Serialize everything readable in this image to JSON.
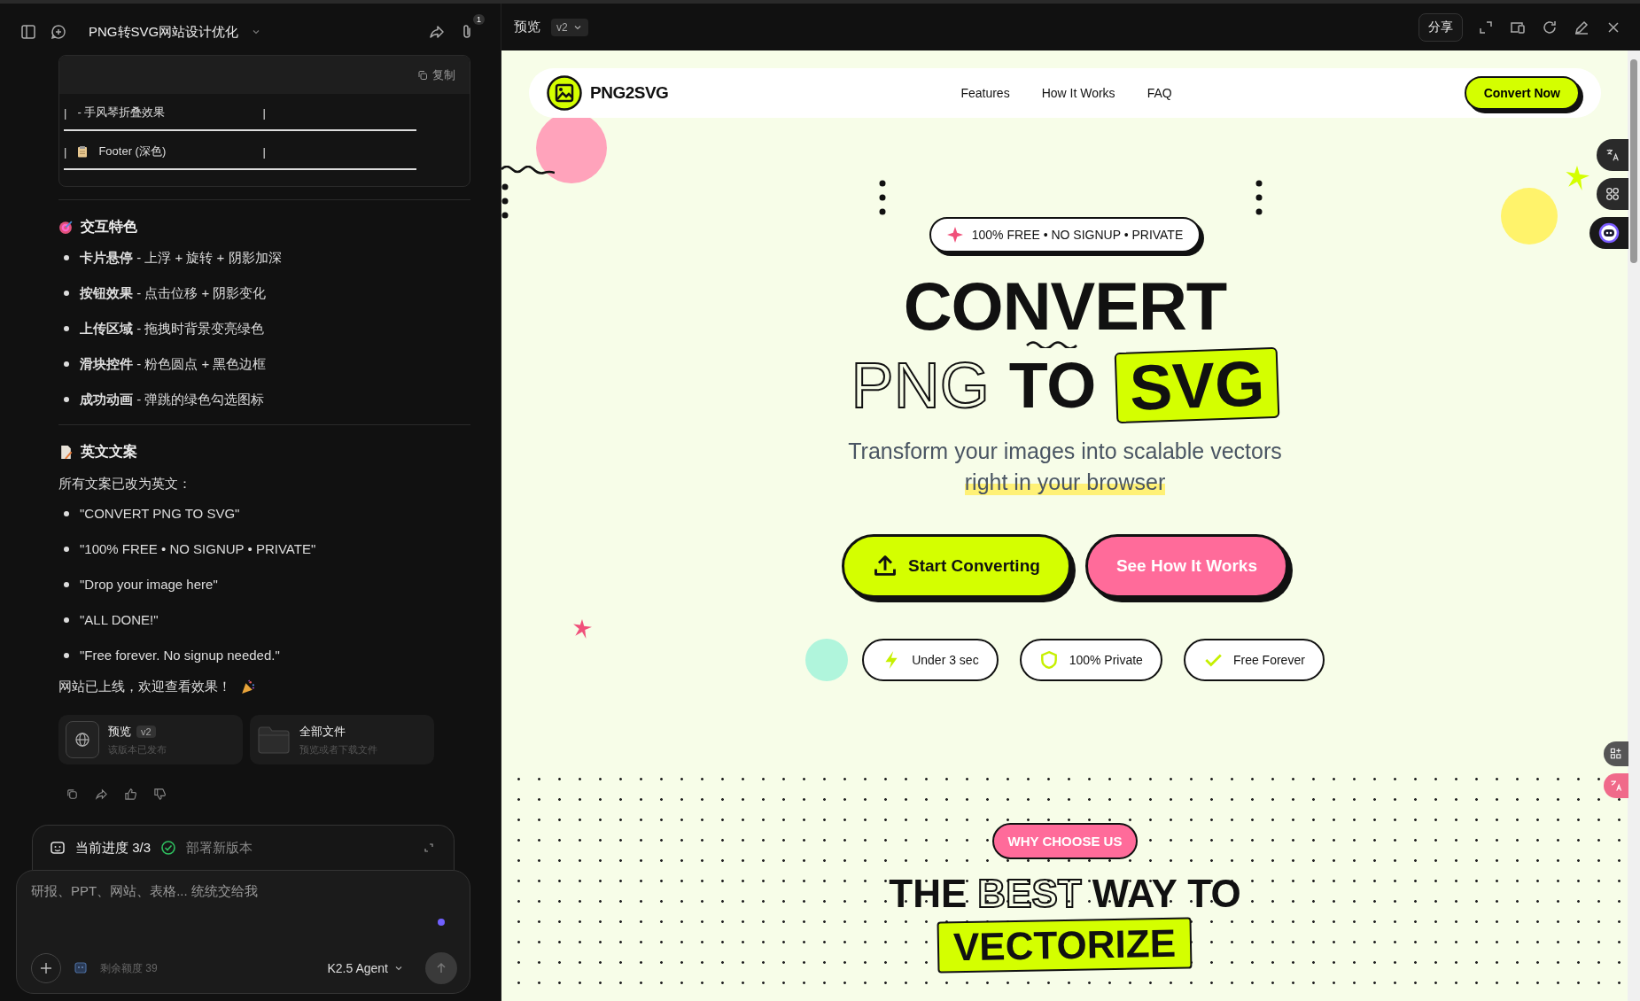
{
  "chat": {
    "title": "PNG转SVG网站设计优化",
    "attachment_count": "1",
    "code_block": {
      "copy_label": "复制",
      "lines": [
        {
          "kind": "text",
          "left": "|",
          "text": "- 手风琴折叠效果",
          "right": "|"
        },
        {
          "kind": "clipboard",
          "left": "|",
          "text": "Footer (深色)",
          "right": "|"
        }
      ]
    },
    "sections": [
      {
        "heading": "交互特色",
        "items": [
          "**卡片悬停** - 上浮 + 旋转 + 阴影加深",
          "**按钮效果** - 点击位移 + 阴影变化",
          "**上传区域** - 拖拽时背景变亮绿色",
          "**滑块控件** - 粉色圆点 + 黑色边框",
          "**成功动画** - 弹跳的绿色勾选图标"
        ]
      },
      {
        "heading": "英文文案",
        "intro": "所有文案已改为英文：",
        "items": [
          "\"CONVERT PNG TO SVG\"",
          "\"100% FREE • NO SIGNUP • PRIVATE\"",
          "\"Drop your image here\"",
          "\"ALL DONE!\"",
          "\"Free forever. No signup needed.\""
        ]
      }
    ],
    "closing": "网站已上线，欢迎查看效果！",
    "cards": [
      {
        "kind": "preview",
        "title": "预览",
        "tag": "v2",
        "subtitle": "该版本已发布"
      },
      {
        "kind": "files",
        "title": "全部文件",
        "subtitle": "预览或者下载文件"
      }
    ],
    "progress": {
      "label": "当前进度 3/3",
      "step": "部署新版本",
      "done": true
    },
    "input": {
      "placeholder": "研报、PPT、网站、表格... 统统交给我",
      "quota": "剩余额度 39",
      "model": "K2.5 Agent"
    }
  },
  "preview": {
    "title": "预览",
    "version": "v2",
    "share": "分享",
    "site": {
      "brand": "PNG2SVG",
      "nav": [
        "Features",
        "How It Works",
        "FAQ"
      ],
      "cta": "Convert Now",
      "pill": "100% FREE • NO SIGNUP • PRIVATE",
      "title_line1": "CONVERT",
      "title_parts": [
        {
          "kind": "outline",
          "text": "PNG"
        },
        {
          "kind": "solid",
          "text": "TO"
        },
        {
          "kind": "highlight",
          "text": "SVG"
        }
      ],
      "subtitle": "Transform your images into scalable vectors",
      "subtitle_highlight": "right in your browser",
      "buttons": [
        {
          "kind": "primary",
          "label": "Start Converting"
        },
        {
          "kind": "secondary",
          "label": "See How It Works"
        }
      ],
      "chips": [
        {
          "kind": "bolt",
          "label": "Under 3 sec"
        },
        {
          "kind": "shield",
          "label": "100% Private"
        },
        {
          "kind": "check",
          "label": "Free Forever"
        }
      ],
      "section_badge": "WHY CHOOSE US",
      "heading_parts": [
        {
          "kind": "solid",
          "text": "THE"
        },
        {
          "kind": "outline",
          "text": "BEST"
        },
        {
          "kind": "solid",
          "text": "WAY TO"
        }
      ],
      "heading_highlight": "VECTORIZE"
    }
  }
}
